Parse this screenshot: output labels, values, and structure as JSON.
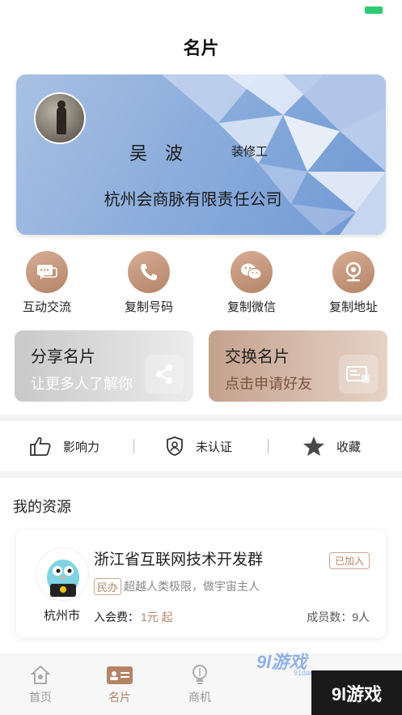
{
  "header": {
    "title": "名片"
  },
  "card": {
    "name": "吴波",
    "job": "装修工",
    "company": "杭州会商脉有限责任公司",
    "bg_color": "#8fb0dd"
  },
  "actions": [
    {
      "label": "互动交流",
      "icon": "chat-icon"
    },
    {
      "label": "复制号码",
      "icon": "phone-icon"
    },
    {
      "label": "复制微信",
      "icon": "wechat-icon"
    },
    {
      "label": "复制地址",
      "icon": "location-icon"
    }
  ],
  "promos": {
    "share": {
      "title": "分享名片",
      "subtitle": "让更多人了解你"
    },
    "exchange": {
      "title": "交换名片",
      "subtitle": "点击申请好友"
    }
  },
  "stats": [
    {
      "label": "影响力",
      "icon": "thumbs-up-icon"
    },
    {
      "label": "未认证",
      "icon": "shield-user-icon"
    },
    {
      "label": "收藏",
      "icon": "star-icon"
    }
  ],
  "resources": {
    "section_title": "我的资源",
    "item": {
      "name": "浙江省互联网技术开发群",
      "status": "已加入",
      "tag": "民办",
      "desc": "超越人类极限，做宇宙主人",
      "city": "杭州市",
      "fee_label": "入会费：",
      "fee_value": "1元 起",
      "members": "成员数：9人"
    }
  },
  "tabbar": [
    {
      "label": "首页",
      "icon": "home-icon",
      "active": false
    },
    {
      "label": "名片",
      "icon": "card-icon",
      "active": true
    },
    {
      "label": "商机",
      "icon": "lightbulb-icon",
      "active": false
    }
  ],
  "watermark": {
    "brand": "9l游戏",
    "site": "91danji.com"
  },
  "colors": {
    "accent": "#b58468",
    "status_battery": "#2ecc71"
  }
}
